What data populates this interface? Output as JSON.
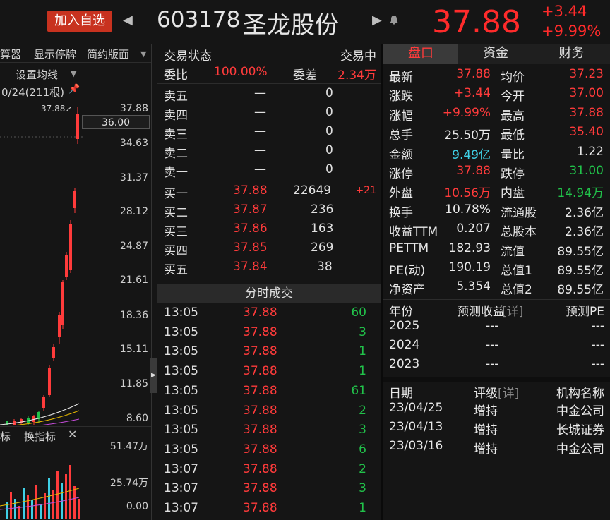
{
  "header": {
    "add_watchlist": "加入自选",
    "code": "603178",
    "name": "圣龙股份",
    "price": "37.88",
    "change_abs": "+3.44",
    "change_pct": "+9.99%"
  },
  "left": {
    "toolbar": [
      "算器",
      "显示停牌",
      "简约版面"
    ],
    "ma_setting": "设置均线",
    "period": "0/24(211根)",
    "price_axis": [
      "37.88",
      "34.63",
      "31.37",
      "28.12",
      "24.87",
      "21.61",
      "18.36",
      "15.11",
      "11.85",
      "8.60"
    ],
    "current_tag": "36.00",
    "peak_label": "37.88",
    "indicator_tabs": [
      "标",
      "换指标"
    ],
    "vol_axis": [
      "51.47万",
      "25.74万",
      "0.00"
    ]
  },
  "book": {
    "status_label": "交易状态",
    "status_value": "交易中",
    "weibi_label": "委比",
    "weibi_value": "100.00%",
    "weicha_label": "委差",
    "weicha_value": "2.34万",
    "asks": [
      {
        "label": "卖五",
        "price": "—",
        "vol": "0"
      },
      {
        "label": "卖四",
        "price": "—",
        "vol": "0"
      },
      {
        "label": "卖三",
        "price": "—",
        "vol": "0"
      },
      {
        "label": "卖二",
        "price": "—",
        "vol": "0"
      },
      {
        "label": "卖一",
        "price": "—",
        "vol": "0"
      }
    ],
    "bids": [
      {
        "label": "买一",
        "price": "37.88",
        "vol": "22649",
        "delta": "+21"
      },
      {
        "label": "买二",
        "price": "37.87",
        "vol": "236",
        "delta": ""
      },
      {
        "label": "买三",
        "price": "37.86",
        "vol": "163",
        "delta": ""
      },
      {
        "label": "买四",
        "price": "37.85",
        "vol": "269",
        "delta": ""
      },
      {
        "label": "买五",
        "price": "37.84",
        "vol": "38",
        "delta": ""
      }
    ]
  },
  "trades": {
    "title": "分时成交",
    "rows": [
      {
        "time": "13:05",
        "price": "37.88",
        "vol": "60"
      },
      {
        "time": "13:05",
        "price": "37.88",
        "vol": "3"
      },
      {
        "time": "13:05",
        "price": "37.88",
        "vol": "1"
      },
      {
        "time": "13:05",
        "price": "37.88",
        "vol": "1"
      },
      {
        "time": "13:05",
        "price": "37.88",
        "vol": "61"
      },
      {
        "time": "13:05",
        "price": "37.88",
        "vol": "2"
      },
      {
        "time": "13:05",
        "price": "37.88",
        "vol": "3"
      },
      {
        "time": "13:05",
        "price": "37.88",
        "vol": "6"
      },
      {
        "time": "13:07",
        "price": "37.88",
        "vol": "2"
      },
      {
        "time": "13:07",
        "price": "37.88",
        "vol": "3"
      },
      {
        "time": "13:07",
        "price": "37.88",
        "vol": "1"
      }
    ]
  },
  "right": {
    "tabs": [
      "盘口",
      "资金",
      "财务"
    ],
    "quotes": [
      {
        "l1": "最新",
        "v1": "37.88",
        "c1": "red",
        "l2": "均价",
        "v2": "37.23",
        "c2": "red"
      },
      {
        "l1": "涨跌",
        "v1": "+3.44",
        "c1": "red",
        "l2": "今开",
        "v2": "37.00",
        "c2": "red"
      },
      {
        "l1": "涨幅",
        "v1": "+9.99%",
        "c1": "red",
        "l2": "最高",
        "v2": "37.88",
        "c2": "red"
      },
      {
        "l1": "总手",
        "v1": "25.50万",
        "c1": "white",
        "l2": "最低",
        "v2": "35.40",
        "c2": "red"
      },
      {
        "l1": "金额",
        "v1": "9.49亿",
        "c1": "cyan",
        "l2": "量比",
        "v2": "1.22",
        "c2": "white"
      },
      {
        "l1": "涨停",
        "v1": "37.88",
        "c1": "red",
        "l2": "跌停",
        "v2": "31.00",
        "c2": "green"
      },
      {
        "l1": "外盘",
        "v1": "10.56万",
        "c1": "red",
        "l2": "内盘",
        "v2": "14.94万",
        "c2": "green"
      },
      {
        "l1": "换手",
        "v1": "10.78%",
        "c1": "white",
        "l2": "流通股",
        "v2": "2.36亿",
        "c2": "white"
      },
      {
        "l1": "收益TTM",
        "v1": "0.207",
        "c1": "white",
        "l2": "总股本",
        "v2": "2.36亿",
        "c2": "white"
      },
      {
        "l1": "PETTM",
        "v1": "182.93",
        "c1": "white",
        "l2": "流值",
        "v2": "89.55亿",
        "c2": "white"
      },
      {
        "l1": "PE(动)",
        "v1": "190.19",
        "c1": "white",
        "l2": "总值1",
        "v2": "89.55亿",
        "c2": "white"
      },
      {
        "l1": "净资产",
        "v1": "5.354",
        "c1": "white",
        "l2": "总值2",
        "v2": "89.55亿",
        "c2": "white"
      }
    ],
    "forecast_header": [
      "年份",
      "预测收益",
      "[详]",
      "预测PE"
    ],
    "forecast_rows": [
      {
        "year": "2025",
        "eps": "---",
        "pe": "---"
      },
      {
        "year": "2024",
        "eps": "---",
        "pe": "---"
      },
      {
        "year": "2023",
        "eps": "---",
        "pe": "---"
      }
    ],
    "rating_header": [
      "日期",
      "评级",
      "[详]",
      "机构名称"
    ],
    "rating_rows": [
      {
        "date": "23/04/25",
        "rating": "增持",
        "org": "中金公司"
      },
      {
        "date": "23/04/13",
        "rating": "增持",
        "org": "长城证券"
      },
      {
        "date": "23/03/16",
        "rating": "增持",
        "org": "中金公司"
      }
    ]
  }
}
